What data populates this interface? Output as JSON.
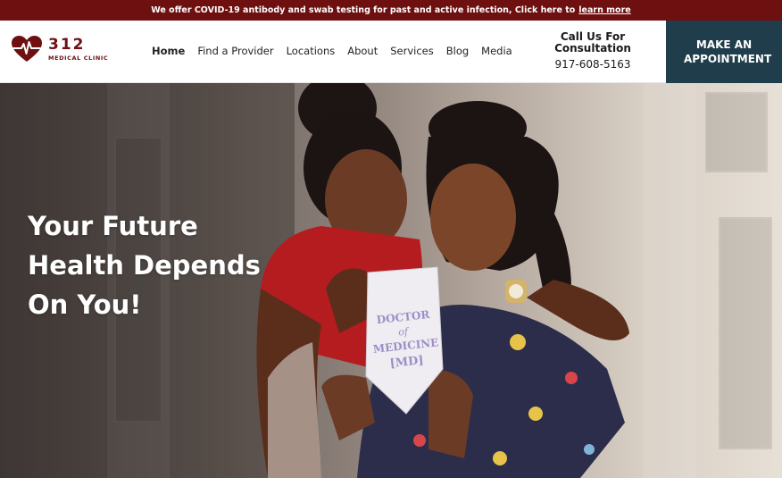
{
  "topbar": {
    "message": "We offer COVID-19 antibody and swab testing for past and active infection, Click here to",
    "link": "learn more"
  },
  "logo": {
    "number": "312",
    "subtitle": "MEDICAL CLINIC"
  },
  "nav": {
    "items": [
      {
        "label": "Home",
        "active": true
      },
      {
        "label": "Find a Provider"
      },
      {
        "label": "Locations"
      },
      {
        "label": "About"
      },
      {
        "label": "Services"
      },
      {
        "label": "Blog"
      },
      {
        "label": "Media"
      }
    ]
  },
  "call": {
    "title": "Call Us For Consultation",
    "phone": "917-608-5163"
  },
  "appointment": {
    "label": "MAKE AN APPOINTMENT"
  },
  "hero": {
    "headline": "Your Future Health Depends On You!",
    "sign": {
      "line1": "DOCTOR",
      "line2": "of",
      "line3": "MEDICINE",
      "line4": "[MD]"
    }
  },
  "colors": {
    "brand": "#6e1010",
    "cta": "#1f3d4a",
    "accent": "#9c8ec8"
  }
}
